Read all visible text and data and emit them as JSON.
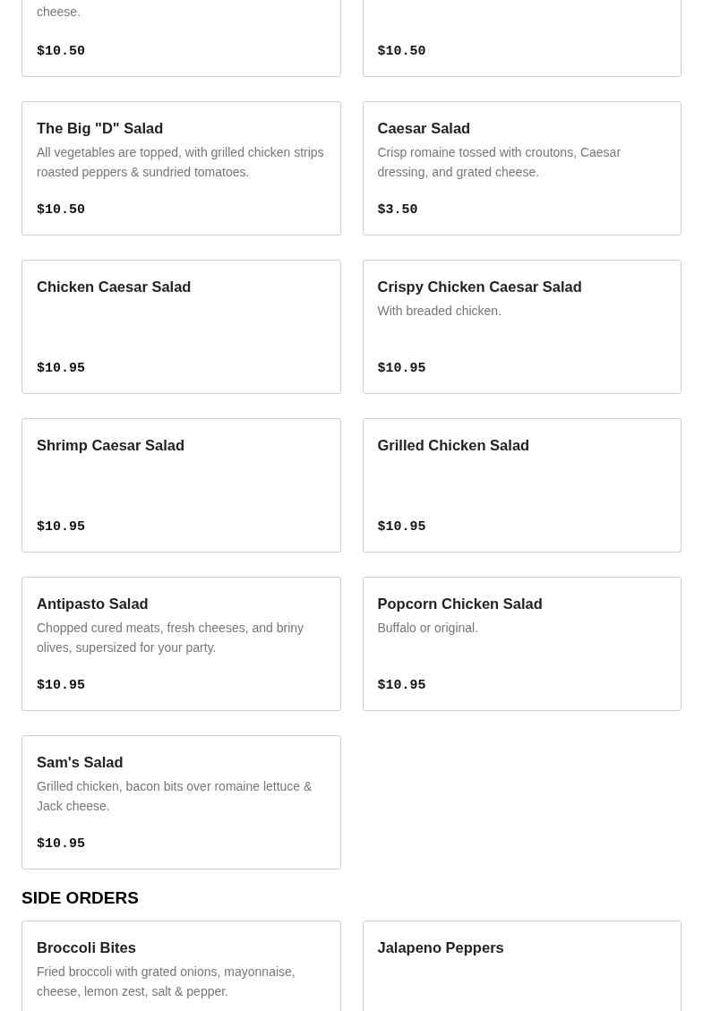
{
  "sections": [
    {
      "items": [
        {
          "description": "cheese.",
          "price": "$10.50"
        },
        {
          "price": "$10.50"
        },
        {
          "title": "The Big \"D\" Salad",
          "description": "All vegetables are topped, with grilled chicken strips roasted peppers & sundried tomatoes.",
          "price": "$10.50"
        },
        {
          "title": "Caesar Salad",
          "description": "Crisp romaine tossed with croutons, Caesar dressing, and grated cheese.",
          "price": "$3.50"
        },
        {
          "title": "Chicken Caesar Salad",
          "price": "$10.95"
        },
        {
          "title": "Crispy Chicken Caesar Salad",
          "description": "With breaded chicken.",
          "price": "$10.95"
        },
        {
          "title": "Shrimp Caesar Salad",
          "price": "$10.95"
        },
        {
          "title": "Grilled Chicken Salad",
          "price": "$10.95"
        },
        {
          "title": "Antipasto Salad",
          "description": "Chopped cured meats, fresh cheeses, and briny olives, supersized for your party.",
          "price": "$10.95"
        },
        {
          "title": "Popcorn Chicken Salad",
          "description": "Buffalo or original.",
          "price": "$10.95"
        },
        {
          "title": "Sam's Salad",
          "description": "Grilled chicken, bacon bits over romaine lettuce & Jack cheese.",
          "price": "$10.95"
        }
      ]
    },
    {
      "title": "SIDE ORDERS",
      "items": [
        {
          "title": "Broccoli Bites",
          "description": "Fried broccoli with grated onions, mayonnaise, cheese, lemon zest, salt & pepper."
        },
        {
          "title": "Jalapeno Peppers"
        }
      ]
    }
  ]
}
